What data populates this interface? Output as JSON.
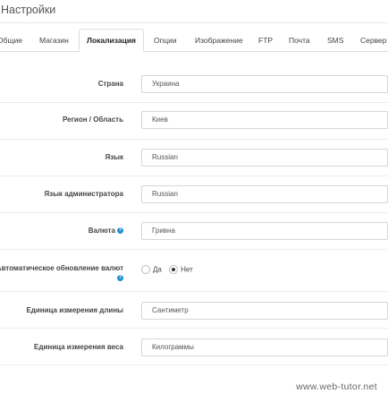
{
  "header": {
    "title": "Настройки"
  },
  "tabs": [
    {
      "label": "Общие"
    },
    {
      "label": "Магазин"
    },
    {
      "label": "Локализация",
      "active": true
    },
    {
      "label": "Опции"
    },
    {
      "label": "Изображение"
    },
    {
      "label": "FTP"
    },
    {
      "label": "Почта"
    },
    {
      "label": "SMS"
    },
    {
      "label": "Сервер"
    }
  ],
  "form": {
    "country": {
      "label": "Страна",
      "value": "Украина"
    },
    "region": {
      "label": "Регион / Область",
      "value": "Киев"
    },
    "language": {
      "label": "Язык",
      "value": "Russian"
    },
    "admin_language": {
      "label": "Язык администратора",
      "value": "Russian"
    },
    "currency": {
      "label": "Валюта",
      "value": "Гривна",
      "help_icon": "question-circle-icon"
    },
    "auto_update": {
      "label": "Автоматическое обновление валют",
      "help_icon": "question-circle-icon",
      "options": [
        "Да",
        "Нет"
      ],
      "selected": "Нет"
    },
    "length_unit": {
      "label": "Единица измерения длины",
      "value": "Сантиметр"
    },
    "weight_unit": {
      "label": "Единица измерения веса",
      "value": "Килограммы"
    }
  },
  "watermark": "www.web-tutor.net",
  "colors": {
    "help_icon": "#1e91cf",
    "border": "#d6d6d6"
  }
}
